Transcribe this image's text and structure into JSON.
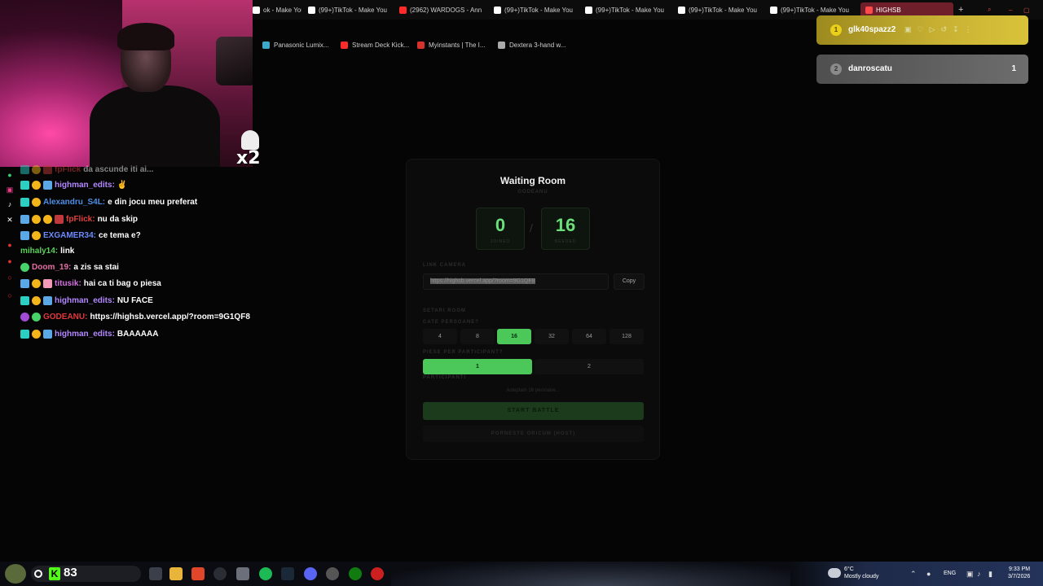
{
  "browser": {
    "tabs": [
      {
        "label": "ok - Make You",
        "icon": "tiktok-icon",
        "color": "#ffffff"
      },
      {
        "label": "(99+)TikTok - Make You",
        "icon": "tiktok-icon",
        "color": "#ffffff"
      },
      {
        "label": "(2962) WARDOGS - Ann",
        "icon": "youtube-icon",
        "color": "#ff2a2a"
      },
      {
        "label": "(99+)TikTok - Make You",
        "icon": "tiktok-icon",
        "color": "#ffffff"
      },
      {
        "label": "(99+)TikTok - Make You",
        "icon": "tiktok-icon",
        "color": "#ffffff"
      },
      {
        "label": "(99+)TikTok - Make You",
        "icon": "tiktok-icon",
        "color": "#ffffff"
      },
      {
        "label": "(99+)TikTok - Make You",
        "icon": "tiktok-icon",
        "color": "#ffffff"
      },
      {
        "label": "HIGHSB",
        "icon": "chart-icon",
        "color": "#ff4a4a",
        "active": true
      }
    ],
    "bookmarks": [
      {
        "label": "Panasonic Lumix...",
        "color": "#3aa9c9"
      },
      {
        "label": "Stream Deck Kick...",
        "color": "#ff2a2a"
      },
      {
        "label": "Myinstants | The I...",
        "color": "#d8322e"
      },
      {
        "label": "Dextera 3-hand w...",
        "color": "#aaaaaa"
      }
    ]
  },
  "overlay": {
    "multiplier": "x2"
  },
  "chat": [
    {
      "user": "fpFlick",
      "color": "#e04040",
      "text": "da ascunde iti ai...",
      "badges": [
        "teal",
        "gold",
        "red"
      ]
    },
    {
      "user": "highman_edits:",
      "color": "#b388ff",
      "text": "✌",
      "badges": [
        "teal",
        "gold",
        "blue"
      ]
    },
    {
      "user": "Alexandru_S4L:",
      "color": "#4e8fe6",
      "text": "e din jocu meu preferat",
      "badges": [
        "teal",
        "gold"
      ]
    },
    {
      "user": "fpFlick:",
      "color": "#e04040",
      "text": "nu da skip",
      "badges": [
        "blue",
        "gold",
        "gold",
        "red"
      ]
    },
    {
      "user": "EXGAMER34:",
      "color": "#6a8cff",
      "text": "ce tema e?",
      "badges": [
        "blue",
        "gold"
      ]
    },
    {
      "user": "mihaly14:",
      "color": "#5bd15b",
      "text": "link",
      "badges": []
    },
    {
      "user": "Doom_19:",
      "color": "#e66ea5",
      "text": "a zis sa stai",
      "badges": [
        "green"
      ]
    },
    {
      "user": "titusik:",
      "color": "#d570e0",
      "text": "hai ca ti bag o piesa",
      "badges": [
        "blue",
        "gold",
        "pink"
      ]
    },
    {
      "user": "highman_edits:",
      "color": "#b388ff",
      "text": "NU FACE",
      "badges": [
        "teal",
        "gold",
        "blue"
      ]
    },
    {
      "user": "GODEANU:",
      "color": "#e0383c",
      "text": "https://highsb.vercel.app/?room=9G1QF8",
      "badges": [
        "purple",
        "green"
      ]
    },
    {
      "user": "highman_edits:",
      "color": "#b388ff",
      "text": "BAAAAAA",
      "badges": [
        "teal",
        "gold",
        "blue"
      ]
    }
  ],
  "room": {
    "title": "Waiting Room",
    "subtitle": "GODEANU",
    "joined": "0",
    "joined_label": "JOINED",
    "needed": "16",
    "needed_label": "NEEDED",
    "slash": "/",
    "link_section": "LINK CAMERA",
    "link": "https://highsb.vercel.app/?room=9G1QF8",
    "copy_label": "Copy",
    "settings_section": "SETARI ROOM",
    "persons_label": "CATE PERSOANE?",
    "persons_options": [
      "4",
      "8",
      "16",
      "32",
      "64",
      "128"
    ],
    "persons_selected": "16",
    "songs_label": "PIESE PER PARTICIPANT?",
    "songs_options": [
      "1",
      "2"
    ],
    "songs_selected": "1",
    "participants_label": "PARTICIPANTI",
    "waiting_text": "Asteptam 16 persoane...",
    "start_label": "START BATTLE",
    "force_label": "PORNESTE ORICUM (HOST)"
  },
  "leaderboard": [
    {
      "rank": "1",
      "name": "glk40spazz2",
      "score": "",
      "color": "#c9b233"
    },
    {
      "rank": "2",
      "name": "danroscatu",
      "score": "1",
      "color": "#6d6d6d"
    }
  ],
  "taskbar": {
    "kick_count": "83",
    "weather_temp": "6°C",
    "weather_desc": "Mostly cloudy",
    "lang": "ENG",
    "time": "9:33 PM",
    "date": "3/7/2026"
  }
}
